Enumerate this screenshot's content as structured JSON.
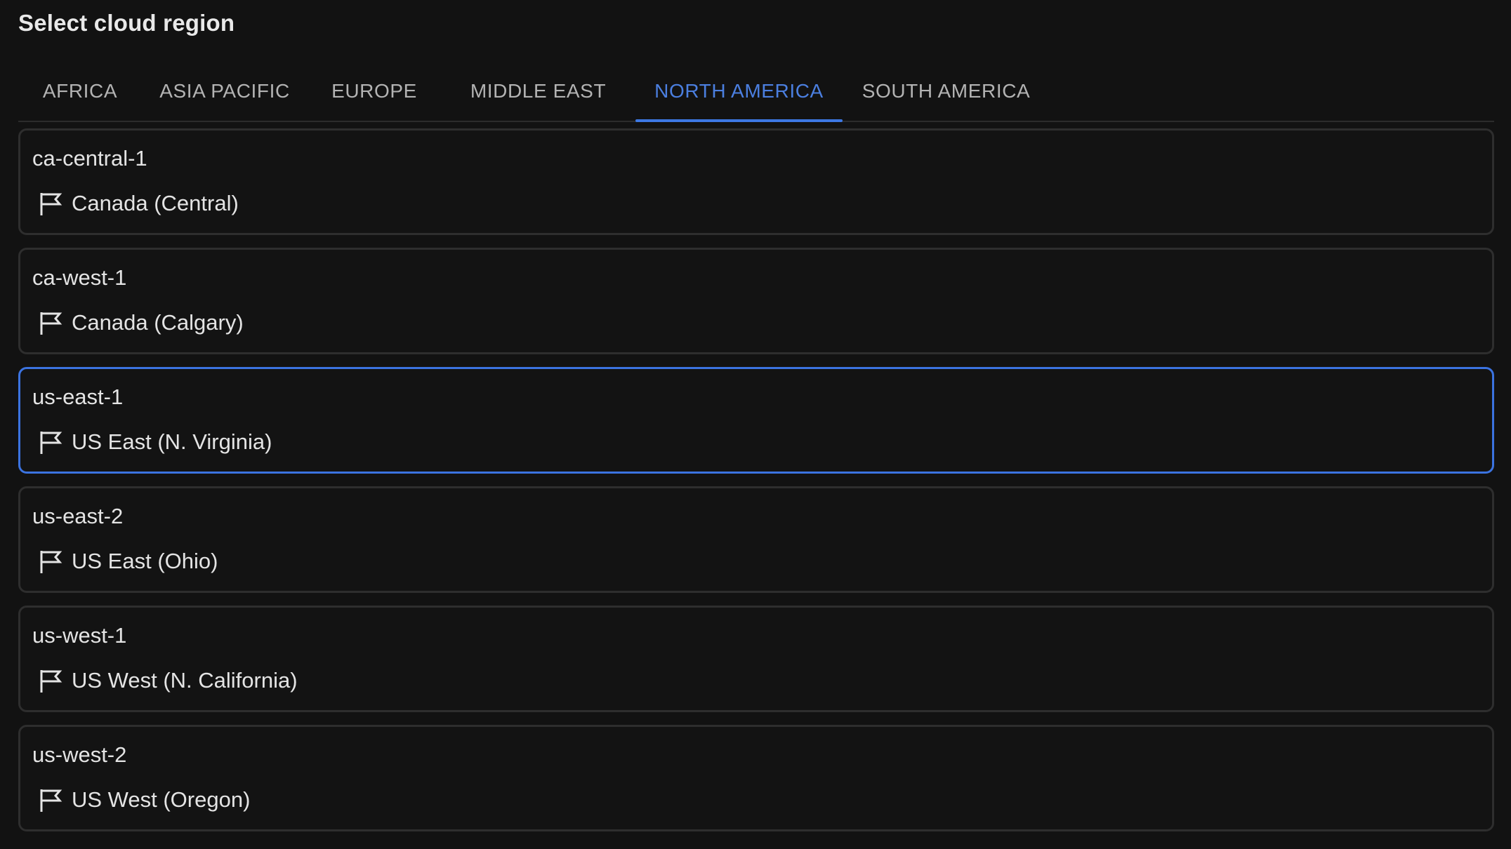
{
  "header": {
    "title": "Select cloud region"
  },
  "tabs": [
    {
      "label": "AFRICA",
      "active": false
    },
    {
      "label": "ASIA PACIFIC",
      "active": false
    },
    {
      "label": "EUROPE",
      "active": false
    },
    {
      "label": "MIDDLE EAST",
      "active": false
    },
    {
      "label": "NORTH AMERICA",
      "active": true
    },
    {
      "label": "SOUTH AMERICA",
      "active": false
    }
  ],
  "regions": [
    {
      "id": "ca-central-1",
      "location": "Canada (Central)",
      "icon": "flag-icon",
      "selected": false
    },
    {
      "id": "ca-west-1",
      "location": "Canada (Calgary)",
      "icon": "flag-icon",
      "selected": false
    },
    {
      "id": "us-east-1",
      "location": "US East (N. Virginia)",
      "icon": "flag-icon",
      "selected": true
    },
    {
      "id": "us-east-2",
      "location": "US East (Ohio)",
      "icon": "flag-icon",
      "selected": false
    },
    {
      "id": "us-west-1",
      "location": "US West (N. California)",
      "icon": "flag-icon",
      "selected": false
    },
    {
      "id": "us-west-2",
      "location": "US West (Oregon)",
      "icon": "flag-icon",
      "selected": false
    }
  ],
  "colors": {
    "background": "#121212",
    "accent": "#3b73e0",
    "card_border": "#2e2e2e",
    "text": "#e4e4e4",
    "tab_inactive": "#b3b3b3"
  }
}
